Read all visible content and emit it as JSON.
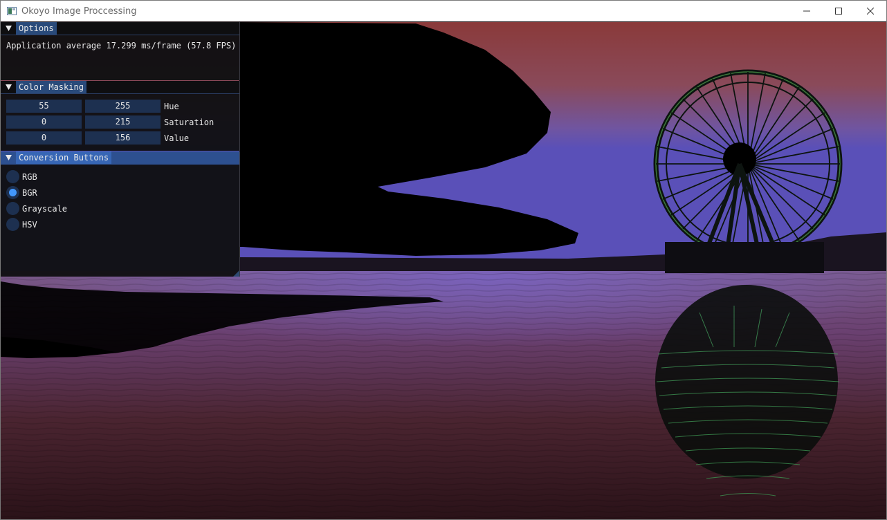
{
  "window": {
    "title": "Okoyo Image Proccessing"
  },
  "options": {
    "title": "Options",
    "fps_text": "Application average 17.299 ms/frame (57.8 FPS)"
  },
  "color_masking": {
    "title": "Color Masking",
    "rows": [
      {
        "label": "Hue",
        "min": "55",
        "max": "255"
      },
      {
        "label": "Saturation",
        "min": "0",
        "max": "215"
      },
      {
        "label": "Value",
        "min": "0",
        "max": "156"
      }
    ]
  },
  "conversion": {
    "title": "Conversion Buttons",
    "options": [
      {
        "label": "RGB",
        "selected": false
      },
      {
        "label": "BGR",
        "selected": true
      },
      {
        "label": "Grayscale",
        "selected": false
      },
      {
        "label": "HSV",
        "selected": false
      }
    ]
  },
  "colors": {
    "accent": "#4296fa",
    "header_active": "#3766b5",
    "frame_bg": "#1d3050"
  }
}
